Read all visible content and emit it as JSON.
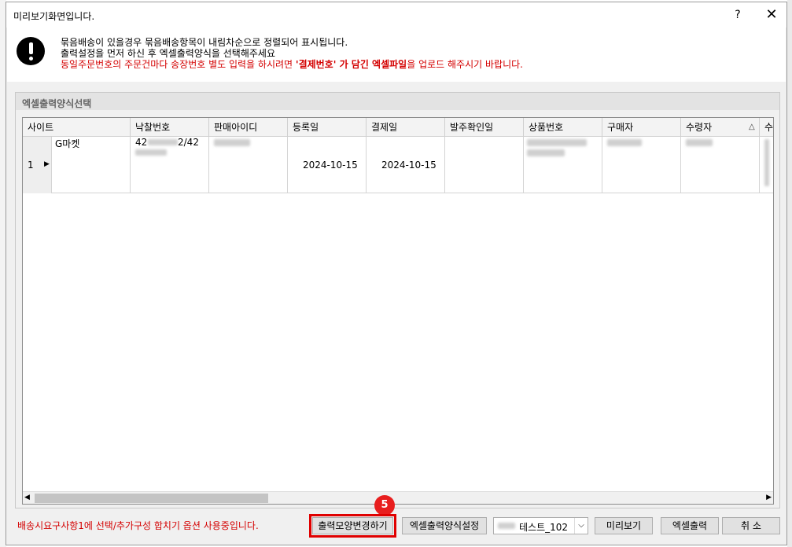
{
  "dialog": {
    "title": "미리보기화면입니다.",
    "help_label": "?",
    "close_label": "✕"
  },
  "info": {
    "line1": "묶음배송이 있을경우 묶음배송항목이 내림차순으로 정렬되어 표시됩니다.",
    "line2": "출력설정을 먼저 하신 후 엑셀출력양식을 선택해주세요",
    "line3_a": "동일주문번호의 주문건마다 송장번호 별도 입력을 하시려면 ",
    "line3_b": "'결제번호' 가 담긴 엑셀파일",
    "line3_c": "을 업로드 해주시기 바랍니다."
  },
  "group": {
    "title": "엑셀출력양식선택"
  },
  "table": {
    "headers": [
      "사이트",
      "낙찰번호",
      "판매아이디",
      "등록일",
      "결제일",
      "발주확인일",
      "상품번호",
      "구매자",
      "수령자",
      "수"
    ],
    "sort_indicator": "△",
    "rows": [
      {
        "index": "1",
        "marker": "▶",
        "site": "G마켓",
        "bid_no_prefix": "42",
        "bid_no_suffix": "2/42",
        "reg_date": "2024-10-15",
        "pay_date": "2024-10-15"
      }
    ]
  },
  "footer": {
    "note": "배송시요구사항1에 선택/추가구성 합치기 옵션 사용중입니다.",
    "btn_change_format": "출력모양변경하기",
    "btn_excel_format_settings": "엑셀출력양식설정",
    "template_select": "테스트_102",
    "btn_preview": "미리보기",
    "btn_excel_export": "엑셀출력",
    "btn_cancel": "취 소",
    "step_badge": "5"
  },
  "scroll": {
    "left_arrow": "◀",
    "right_arrow": "▶",
    "dropdown_arrow": "⌵"
  },
  "colors": {
    "highlight": "#e00000",
    "warning_text": "#d40000",
    "badge": "#e81e1e"
  }
}
